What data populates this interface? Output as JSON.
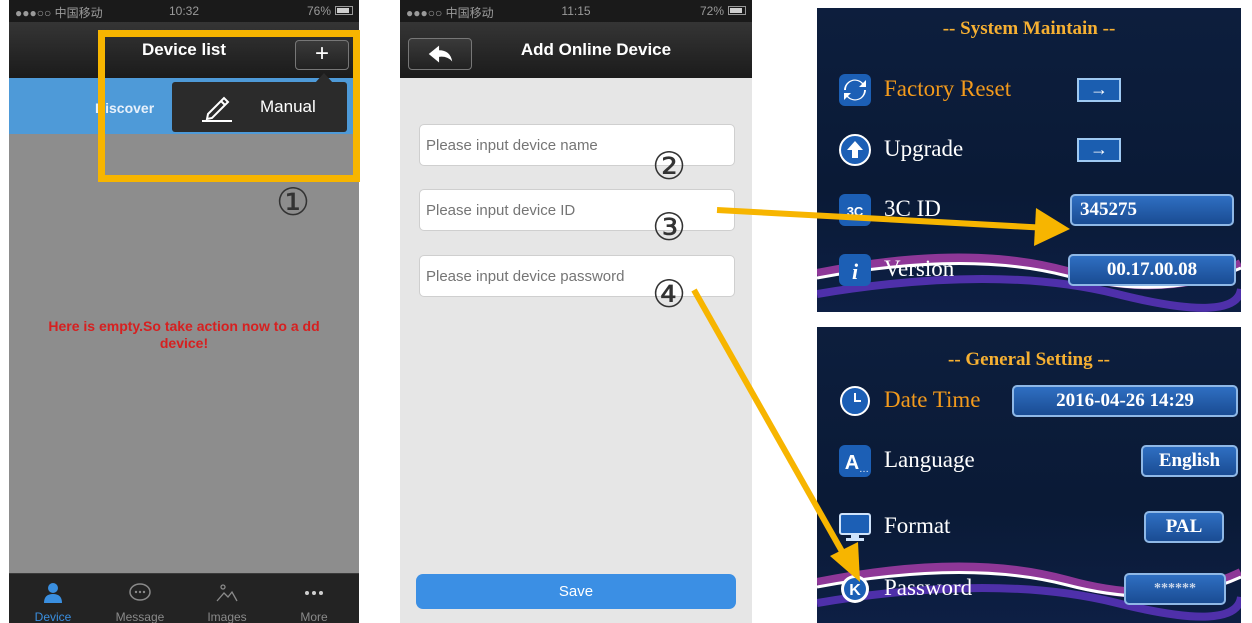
{
  "phone1": {
    "status": {
      "carrier": "●●●○○ 中国移动",
      "time": "10:32",
      "battery": "76%"
    },
    "title": "Device list",
    "plus_label": "+",
    "discover": "Discover",
    "popup_item": "Manual",
    "empty_message": "Here is empty.So take action now to a dd device!",
    "tabs": [
      {
        "label": "Device",
        "icon": "person-icon",
        "active": true
      },
      {
        "label": "Message",
        "icon": "chat-bubble-icon",
        "active": false
      },
      {
        "label": "Images",
        "icon": "image-icon",
        "active": false
      },
      {
        "label": "More",
        "icon": "more-dots-icon",
        "active": false
      }
    ]
  },
  "phone2": {
    "status": {
      "carrier": "●●●○○ 中国移动",
      "time": "11:15",
      "battery": "72%"
    },
    "title": "Add Online Device",
    "fields": [
      {
        "placeholder": "Please input device name"
      },
      {
        "placeholder": "Please input device ID"
      },
      {
        "placeholder": "Please input device password"
      }
    ],
    "save_label": "Save"
  },
  "annotations": {
    "step1": "①",
    "step2": "②",
    "step3": "③",
    "step4": "④",
    "highlight_color": "#f7b500"
  },
  "osd_system": {
    "title": "-- System Maintain --",
    "factory_reset": "Factory Reset",
    "upgrade": "Upgrade",
    "arrow": "→",
    "cid_label": "3C ID",
    "cid_value": "345275",
    "version_label": "Version",
    "version_value": "00.17.00.08"
  },
  "osd_general": {
    "title": "-- General Setting --",
    "date_time_label": "Date Time",
    "date_time_value": "2016-04-26   14:29",
    "language_label": "Language",
    "language_value": "English",
    "format_label": "Format",
    "format_value": "PAL",
    "password_label": "Password",
    "password_value": "******"
  }
}
